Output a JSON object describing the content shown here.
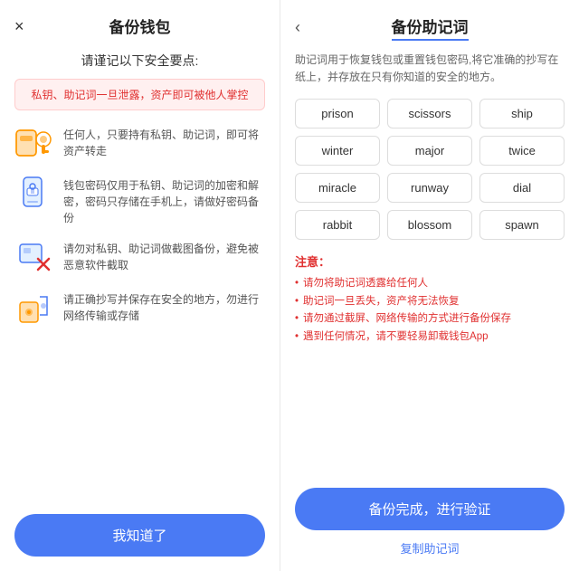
{
  "left": {
    "title": "备份钱包",
    "close_icon": "×",
    "safety_heading": "请谨记以下安全要点:",
    "warning_text": "私钥、助记词一旦泄露，资产即可被他人掌控",
    "items": [
      {
        "icon": "key-icon",
        "text": "任何人，只要持有私钥、助记词，即可将资产转走"
      },
      {
        "icon": "phone-icon",
        "text": "钱包密码仅用于私钥、助记词的加密和解密，密码只存储在手机上，请做好密码备份"
      },
      {
        "icon": "scan-icon",
        "text": "请勿对私钥、助记词做截图备份，避免被恶意软件截取"
      },
      {
        "icon": "location-icon",
        "text": "请正确抄写并保存在安全的地方，勿进行网络传输或存储"
      }
    ],
    "know_button": "我知道了"
  },
  "right": {
    "back_icon": "‹",
    "title": "备份助记词",
    "description": "助记词用于恢复钱包或重置钱包密码,将它准确的抄写在纸上，并存放在只有你知道的安全的地方。",
    "mnemonic_words": [
      "prison",
      "scissors",
      "ship",
      "winter",
      "major",
      "twice",
      "miracle",
      "runway",
      "dial",
      "rabbit",
      "blossom",
      "spawn"
    ],
    "notes_title": "注意：",
    "notes": [
      "请勿将助记词透露给任何人",
      "助记词一旦丢失，资产将无法恢复",
      "请勿通过截屏、网络传输的方式进行备份保存",
      "遇到任何情况，请不要轻易卸载钱包App"
    ],
    "verify_button": "备份完成，进行验证",
    "copy_link": "复制助记词"
  }
}
